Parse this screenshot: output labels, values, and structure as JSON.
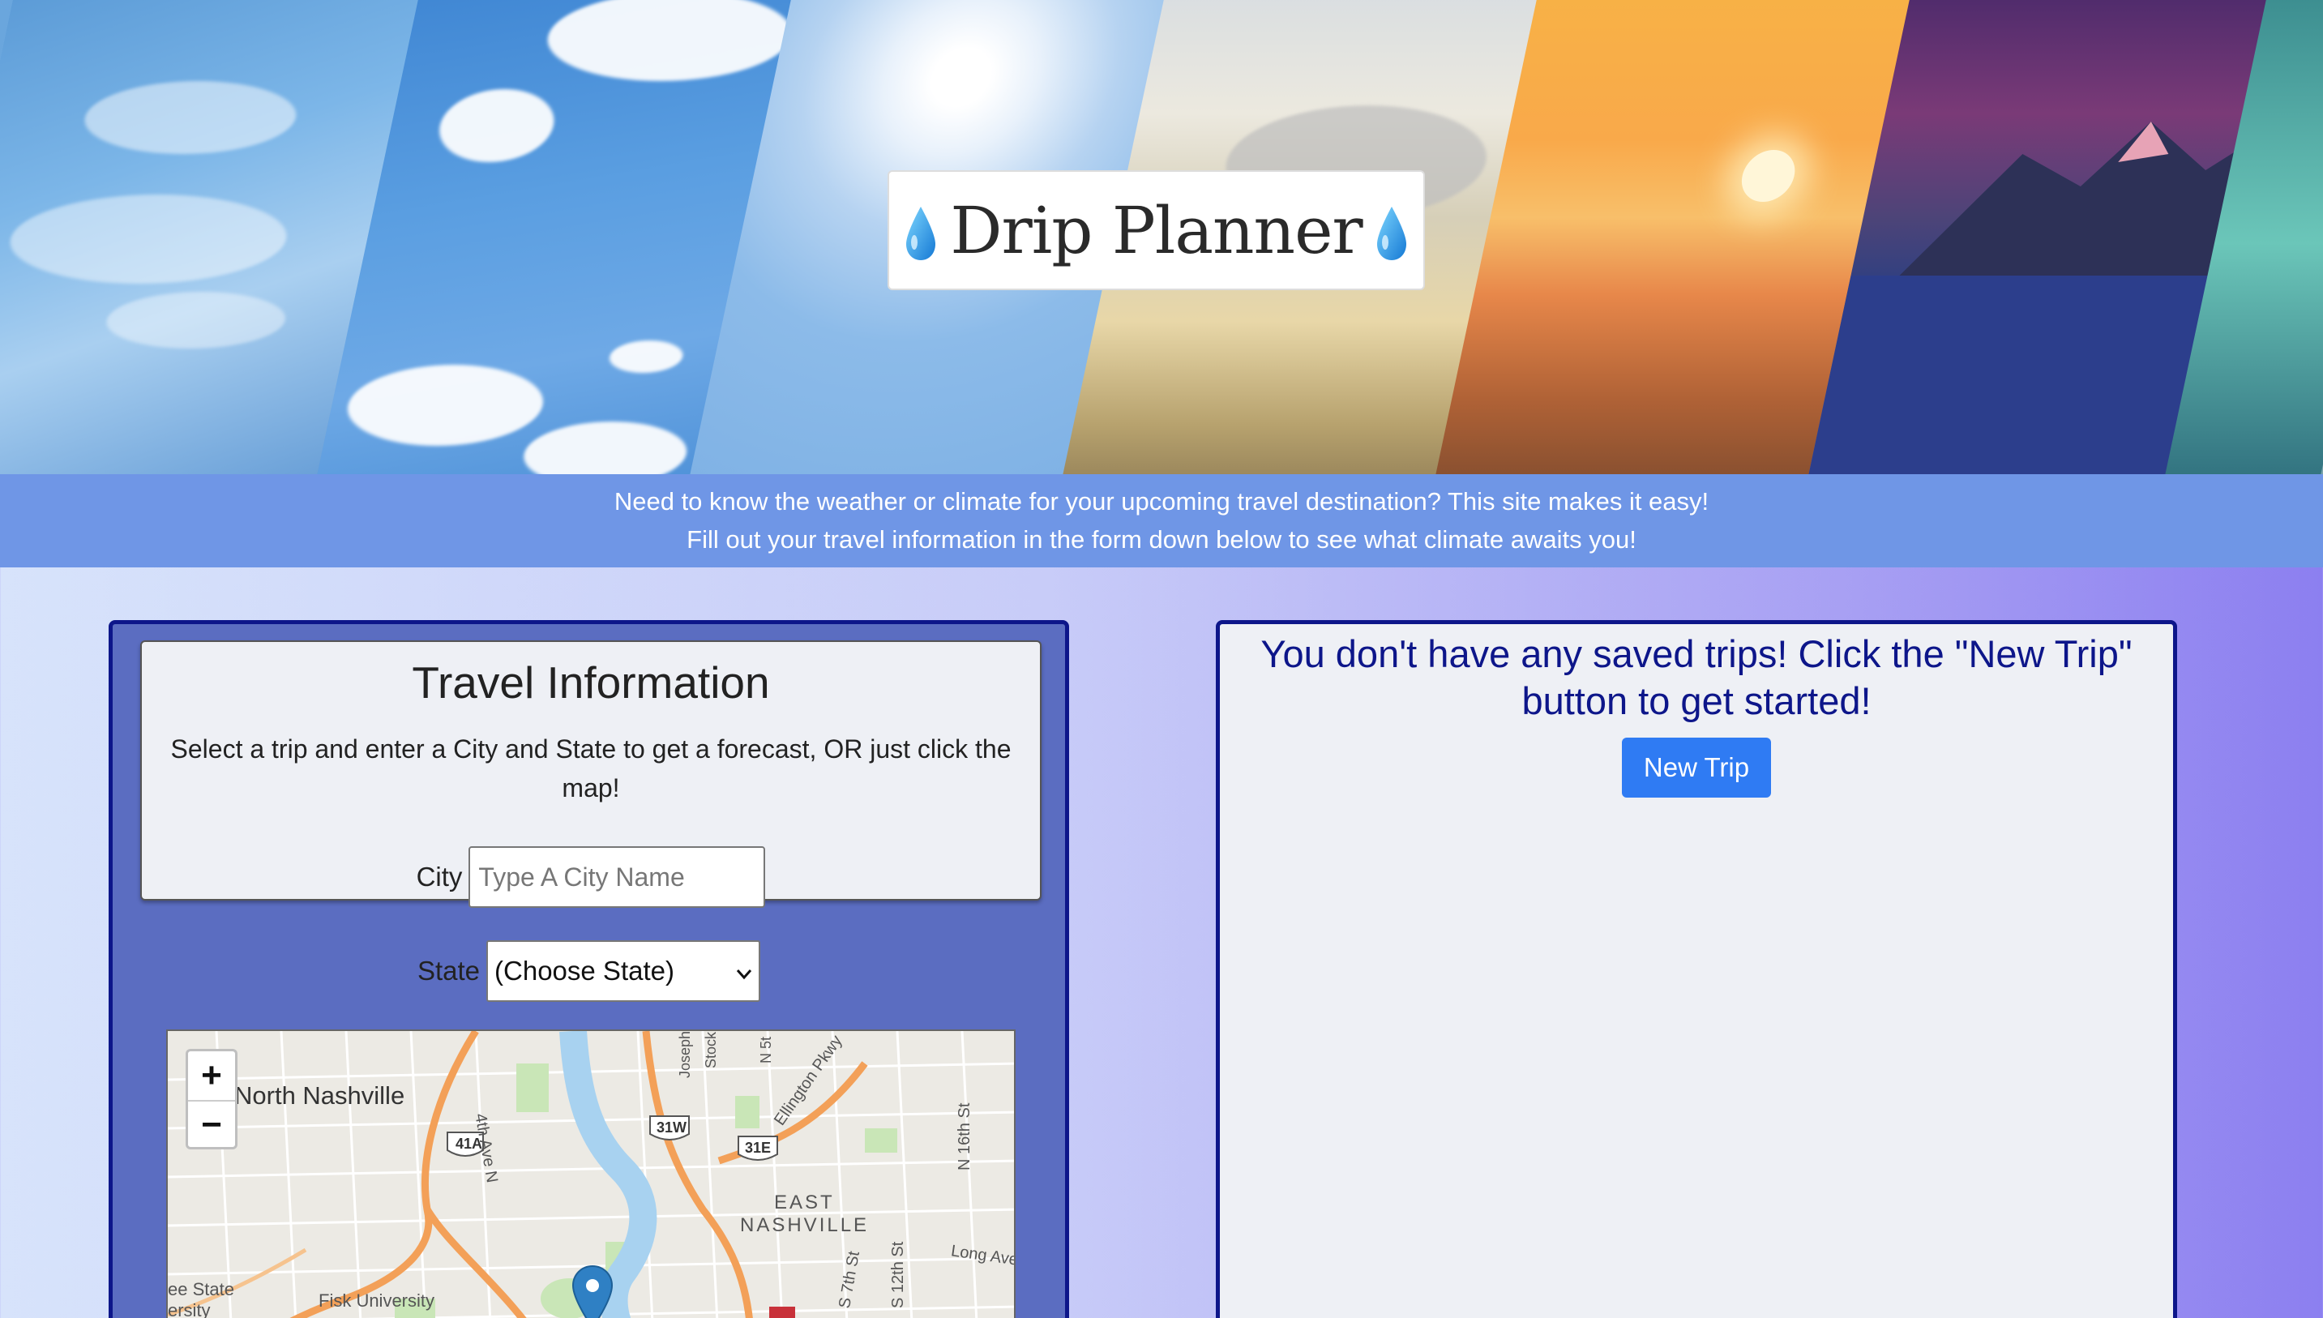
{
  "header": {
    "title": "Drip Planner",
    "drop_icon_left": "droplet-icon",
    "drop_icon_right": "droplet-icon"
  },
  "banner": {
    "line1": "Need to know the weather or climate for your upcoming travel destination? This site makes it easy!",
    "line2": "Fill out your travel information in the form down below to see what climate awaits you!"
  },
  "travel_form": {
    "title": "Travel Information",
    "description": "Select a trip and enter a City and State to get a forecast, OR just click the map!",
    "city_label": "City",
    "city_placeholder": "Type A City Name",
    "city_value": "",
    "state_label": "State",
    "state_selected": "(Choose State)"
  },
  "map": {
    "zoom_in": "+",
    "zoom_out": "−",
    "labels": {
      "north_nashville": "North Nashville",
      "east_nashville_1": "EAST",
      "east_nashville_2": "NASHVILLE",
      "fisk": "Fisk University",
      "state_univ_1": "ee State",
      "state_univ_2": "ersity",
      "ave_4th": "4th Ave N",
      "n16": "N 16th St",
      "ellington": "Ellington Pkwy",
      "long_ave": "Long Ave",
      "s7": "S 7th St",
      "s12": "S 12th St",
      "joseph": "Joseph",
      "stock": "Stock",
      "n5": "N 5t",
      "shield_41a": "41A",
      "shield_31w": "31W",
      "shield_31e": "31E"
    }
  },
  "trips": {
    "empty_message": "You don't have any saved trips! Click the \"New Trip\" button to get started!",
    "new_trip_label": "New Trip"
  },
  "colors": {
    "accent_blue": "#2f7bf3",
    "border_navy": "#0d168a",
    "banner_blue": "#6f96e6",
    "form_panel": "#5b6dc1"
  }
}
